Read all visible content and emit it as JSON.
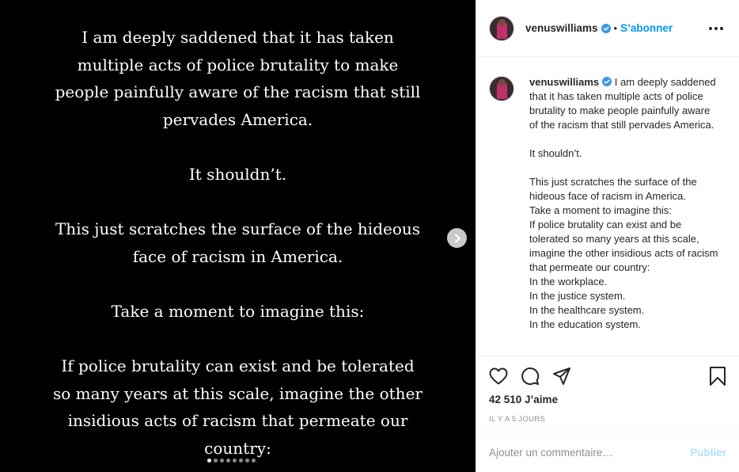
{
  "post": {
    "slide_text": [
      "I am deeply saddened that it has taken multiple acts of police brutality to make people painfully aware of the racism that still pervades America.",
      "It shouldn’t.",
      "This just scratches the surface of the hideous face of racism in America.",
      "Take a moment to imagine this:",
      "If police brutality can exist and be tolerated so many years at this scale, imagine the other insidious acts of racism that permeate our country:"
    ],
    "carousel": {
      "total_slides": 8,
      "active_slide": 1
    },
    "next_icon": "chevron-right-icon"
  },
  "header": {
    "username": "venuswilliams",
    "separator": "•",
    "follow_label": "S’abonner",
    "more_icon": "more-options-icon"
  },
  "caption": {
    "username": "venuswilliams",
    "intro": "I am deeply saddened that it has taken multiple acts of police brutality to make people painfully aware of the racism that still pervades America.",
    "para2": "It shouldn’t.",
    "para3": "This just scratches the surface of the hideous face of racism in America.\nTake a moment to imagine this:\nIf police brutality can exist and be tolerated so many years at this scale, imagine the other insidious acts of racism that permeate our country:\nIn the workplace.\nIn the justice system.\nIn the healthcare system.\nIn the education system."
  },
  "actions": {
    "like_icon": "heart-icon",
    "comment_icon": "comment-icon",
    "share_icon": "share-icon",
    "save_icon": "bookmark-icon"
  },
  "likes_label": "42 510 J’aime",
  "time_label": "IL Y A 5 JOURS",
  "comment": {
    "placeholder": "Ajouter un commentaire…",
    "post_label": "Publier"
  },
  "colors": {
    "accent": "#0095f6",
    "post_disabled": "#b2dffc",
    "verified": "#3897f0"
  }
}
